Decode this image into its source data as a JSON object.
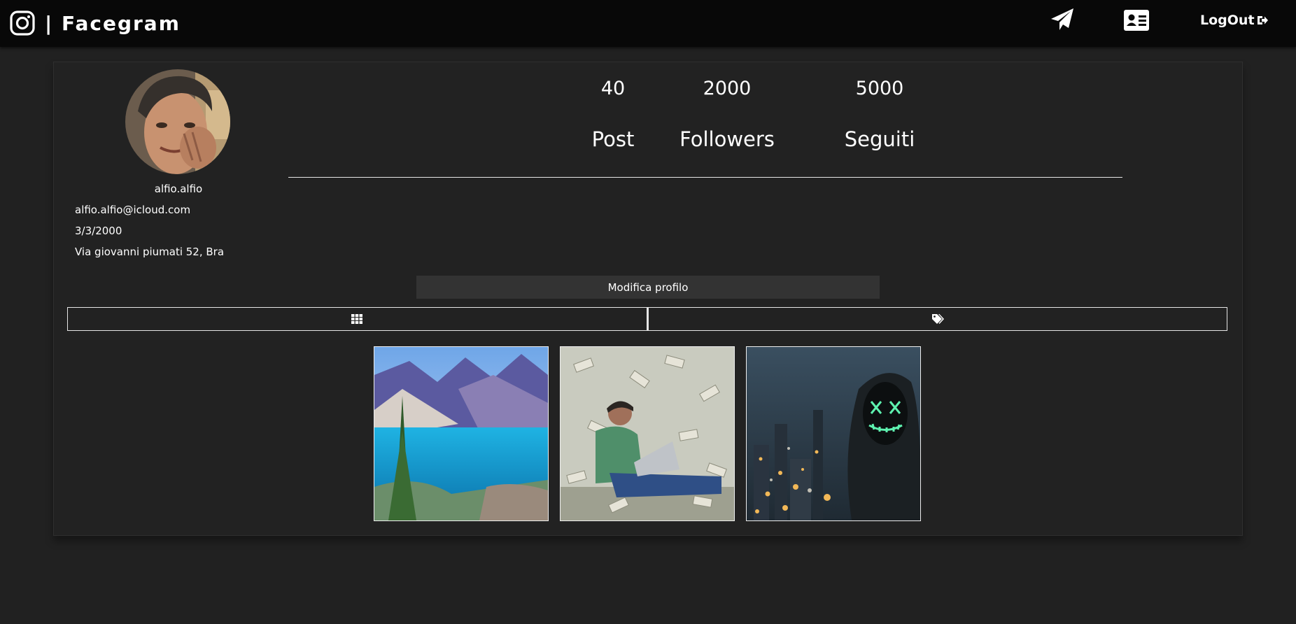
{
  "header": {
    "brand": "| Facegram",
    "logout_label": "LogOut"
  },
  "profile": {
    "username": "alfio.alfio",
    "email": "alfio.alfio@icloud.com",
    "birthdate": "3/3/2000",
    "address": "Via giovanni piumati 52, Bra"
  },
  "stats": [
    {
      "value": "40",
      "label": "Post"
    },
    {
      "value": "2000",
      "label": "Followers"
    },
    {
      "value": "5000",
      "label": "Seguiti"
    }
  ],
  "edit_button_label": "Modifica profilo",
  "tabs": [
    {
      "icon": "grid-icon"
    },
    {
      "icon": "tags-icon"
    }
  ],
  "posts": [
    {
      "subject": "mountain-lake"
    },
    {
      "subject": "man-laptop-money"
    },
    {
      "subject": "hooded-mask-city"
    }
  ]
}
